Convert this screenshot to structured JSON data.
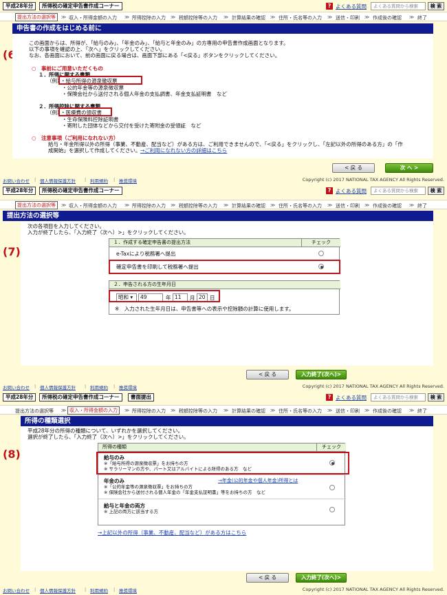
{
  "common": {
    "badge_year": "平成28年分",
    "badge_corner": "所得税の確定申告書作成コーナー",
    "badge_print": "書面提出",
    "faq_icon": "?",
    "faq_link": "よくある質問",
    "faq_placeholder": "よくある質問から検索",
    "faq_search": "検 索",
    "steps": [
      "提出方法の選択等",
      "収入・所得金額の入力",
      "所得控除の入力",
      "税額控除等の入力",
      "計算結果の確認",
      "住所・氏名等の入力",
      "送信・印刷",
      "作成後の確認",
      "終了"
    ],
    "back": "< 戻 る",
    "footer": [
      "お問い合わせ",
      "個人情報保護方針",
      "利用規約",
      "推奨環境"
    ],
    "copyright": "Copyright (c) 2017 NATIONAL TAX AGENCY All Rights Reserved."
  },
  "p6": {
    "label": "(6)",
    "title": "申告書の作成をはじめる前に",
    "intro1": "この画面からは、所得が、「給与のみ」、「年金のみ」、「給与と年金のみ」の方専用の申告書作成画面となります。",
    "intro2": "以下の事項を確認の上、「次へ」をクリックしてください。",
    "intro3": "なお、各画面において、前の画面に戻る場合は、画面下部にある「<戻る」ボタンをクリックしてください。",
    "prep_head": "○　事前にご用意いただくもの",
    "sec1": "１．所得に関する書類",
    "ex": "（例）",
    "sec1_a": "・給与所得の源泉徴収票",
    "sec1_b": "・公的年金等の源泉徴収票",
    "sec1_c": "・保険会社から送付される個人年金の支払調書、年金支払証明書　など",
    "sec2": "２．所得控除に関する書類",
    "sec2_a": "・医療費の領収書",
    "sec2_b": "・生命保険料控除証明書",
    "sec2_c": "・寄附した団体などから交付を受けた寄附金の受領証　など",
    "note_head": "○　注意事項（ご利用になれない方）",
    "note1": "給与・年金所得以外の所得（事業、不動産、配当など）がある方は、ご利用できませんので、「<戻る」をクリックし、「左記以外の所得のある方」の「作",
    "note2": "成開始」を選択して作成してください。",
    "note_link": "→ご利用になれない方の詳細はこちら",
    "next": "次 へ >"
  },
  "p7": {
    "label": "(7)",
    "title": "提出方法の選択等",
    "intro1": "次の各項目を入力してください。",
    "intro2": "入力が終了したら、「入力終了（次へ）>」をクリックしてください。",
    "t1_head": "１．作成する確定申告書の提出方法",
    "check": "チェック",
    "opt_etax": "e-Taxにより税務署へ提出",
    "opt_print": "確定申告書を印刷して税務署へ提出",
    "t2_head": "２．申告される方の生年月日",
    "era": "昭和",
    "year": "49",
    "year_unit": "年",
    "month": "11",
    "month_unit": "月",
    "day": "20",
    "day_unit": "日",
    "dob_note": "※　入力された生年月日は、申告書等への表示や控除額の計算に使用します。",
    "next": "入力終了(次へ)>"
  },
  "p8": {
    "label": "(8)",
    "title": "所得の種類選択",
    "intro1": "平成28年分の所得の種類について、いずれかを選択してください。",
    "intro2": "選択が終了したら、「入力終了（次へ）>」をクリックしてください。",
    "th_kind": "所得の種類",
    "th_check": "チェック",
    "r1_title": "給与のみ",
    "r1_a": "※「給与所得の源泉徴収票」をお持ちの方",
    "r1_b": "※ サラリーマンの方や、パート又はアルバイトによる所得のある方　など",
    "r2_title": "年金のみ",
    "r2_link": "→年金(公的年金や個人年金)所得とは",
    "r2_a": "※「公的年金等の源泉徴収票」をお持ちの方",
    "r2_b": "※ 保険会社から送付される個人年金の「年金支払証明書」等をお持ちの方　など",
    "r3_title": "給与と年金の両方",
    "r3_a": "※ 上記の両方に該当する方",
    "other_link": "→上記以外の所得（事業、不動産、配当など）がある方はこちら",
    "next": "入力終了(次へ)>"
  }
}
